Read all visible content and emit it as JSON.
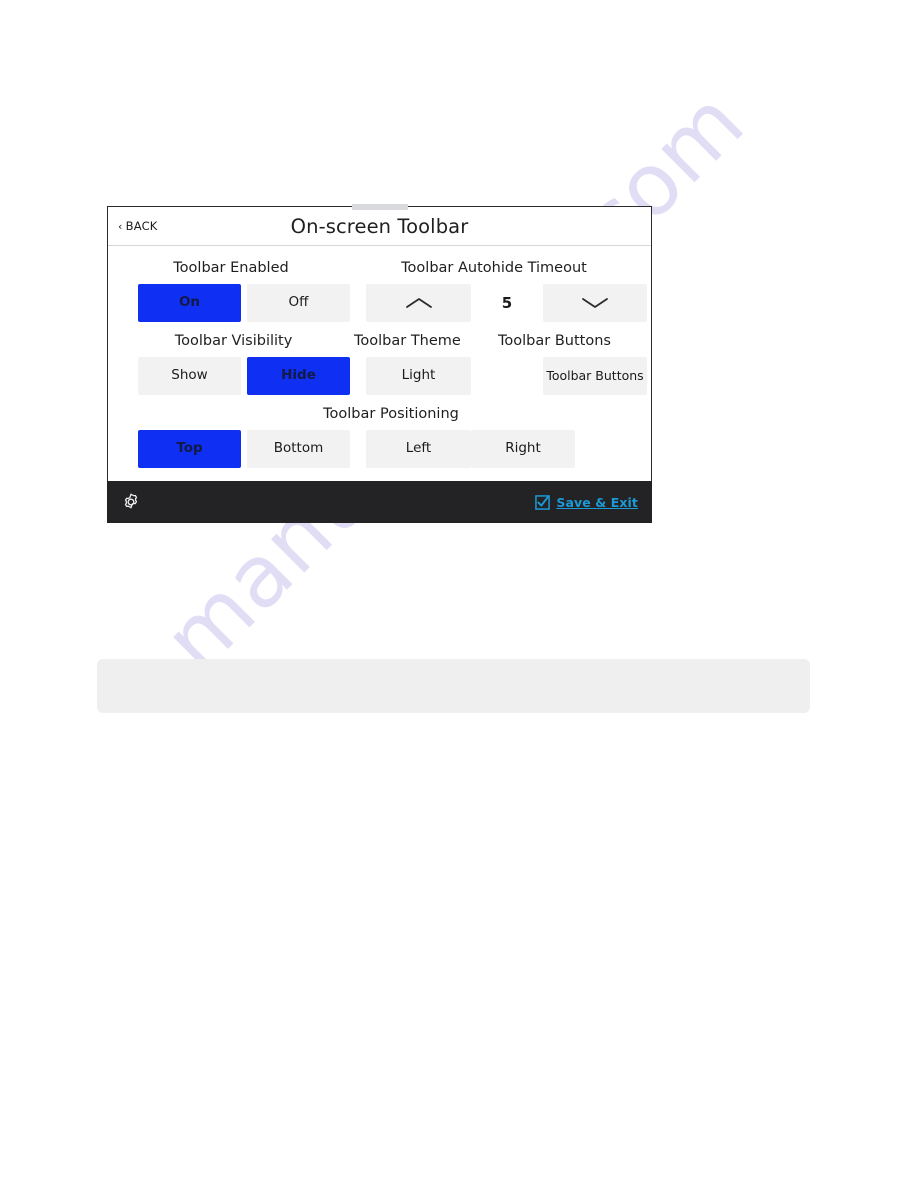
{
  "page": {
    "watermark": "manualshive.com"
  },
  "device": {
    "titlebar": {
      "back_label": "BACK",
      "back_chevron": "‹",
      "title": "On-screen Toolbar"
    },
    "groups": [
      {
        "name": "toolbar-enabled",
        "label": "Toolbar Enabled",
        "options": [
          {
            "label": "On",
            "active": true
          },
          {
            "label": "Off",
            "active": false
          }
        ]
      },
      {
        "name": "toolbar-autohide-timeout",
        "label": "Toolbar Autohide Timeout",
        "increment_icon": "chevron-up-icon",
        "decrement_icon": "chevron-down-icon",
        "value": "5"
      },
      {
        "name": "toolbar-visibility",
        "label": "Toolbar Visibility",
        "options": [
          {
            "label": "Show",
            "active": false
          },
          {
            "label": "Hide",
            "active": true
          }
        ]
      },
      {
        "name": "toolbar-theme",
        "label": "Toolbar Theme",
        "options": [
          {
            "label": "Light",
            "active": false
          }
        ]
      },
      {
        "name": "toolbar-buttons",
        "label": "Toolbar Buttons",
        "options": [
          {
            "label": "Toolbar Buttons",
            "active": false
          }
        ]
      },
      {
        "name": "toolbar-positioning",
        "label": "Toolbar Positioning",
        "options": [
          {
            "label": "Top",
            "active": true
          },
          {
            "label": "Bottom",
            "active": false
          },
          {
            "label": "Left",
            "active": false
          },
          {
            "label": "Right",
            "active": false
          }
        ]
      }
    ],
    "bottombar": {
      "settings_icon": "gear-icon",
      "save_checkbox_icon": "checkbox-checked-icon",
      "save_label": "Save & Exit"
    }
  },
  "colors": {
    "accent_blue": "#0f2ff2",
    "link_cyan": "#1b9ad6",
    "bottom_bar": "#232326",
    "segment_bg": "#f2f2f2",
    "watermark": "#c7c3ee"
  }
}
